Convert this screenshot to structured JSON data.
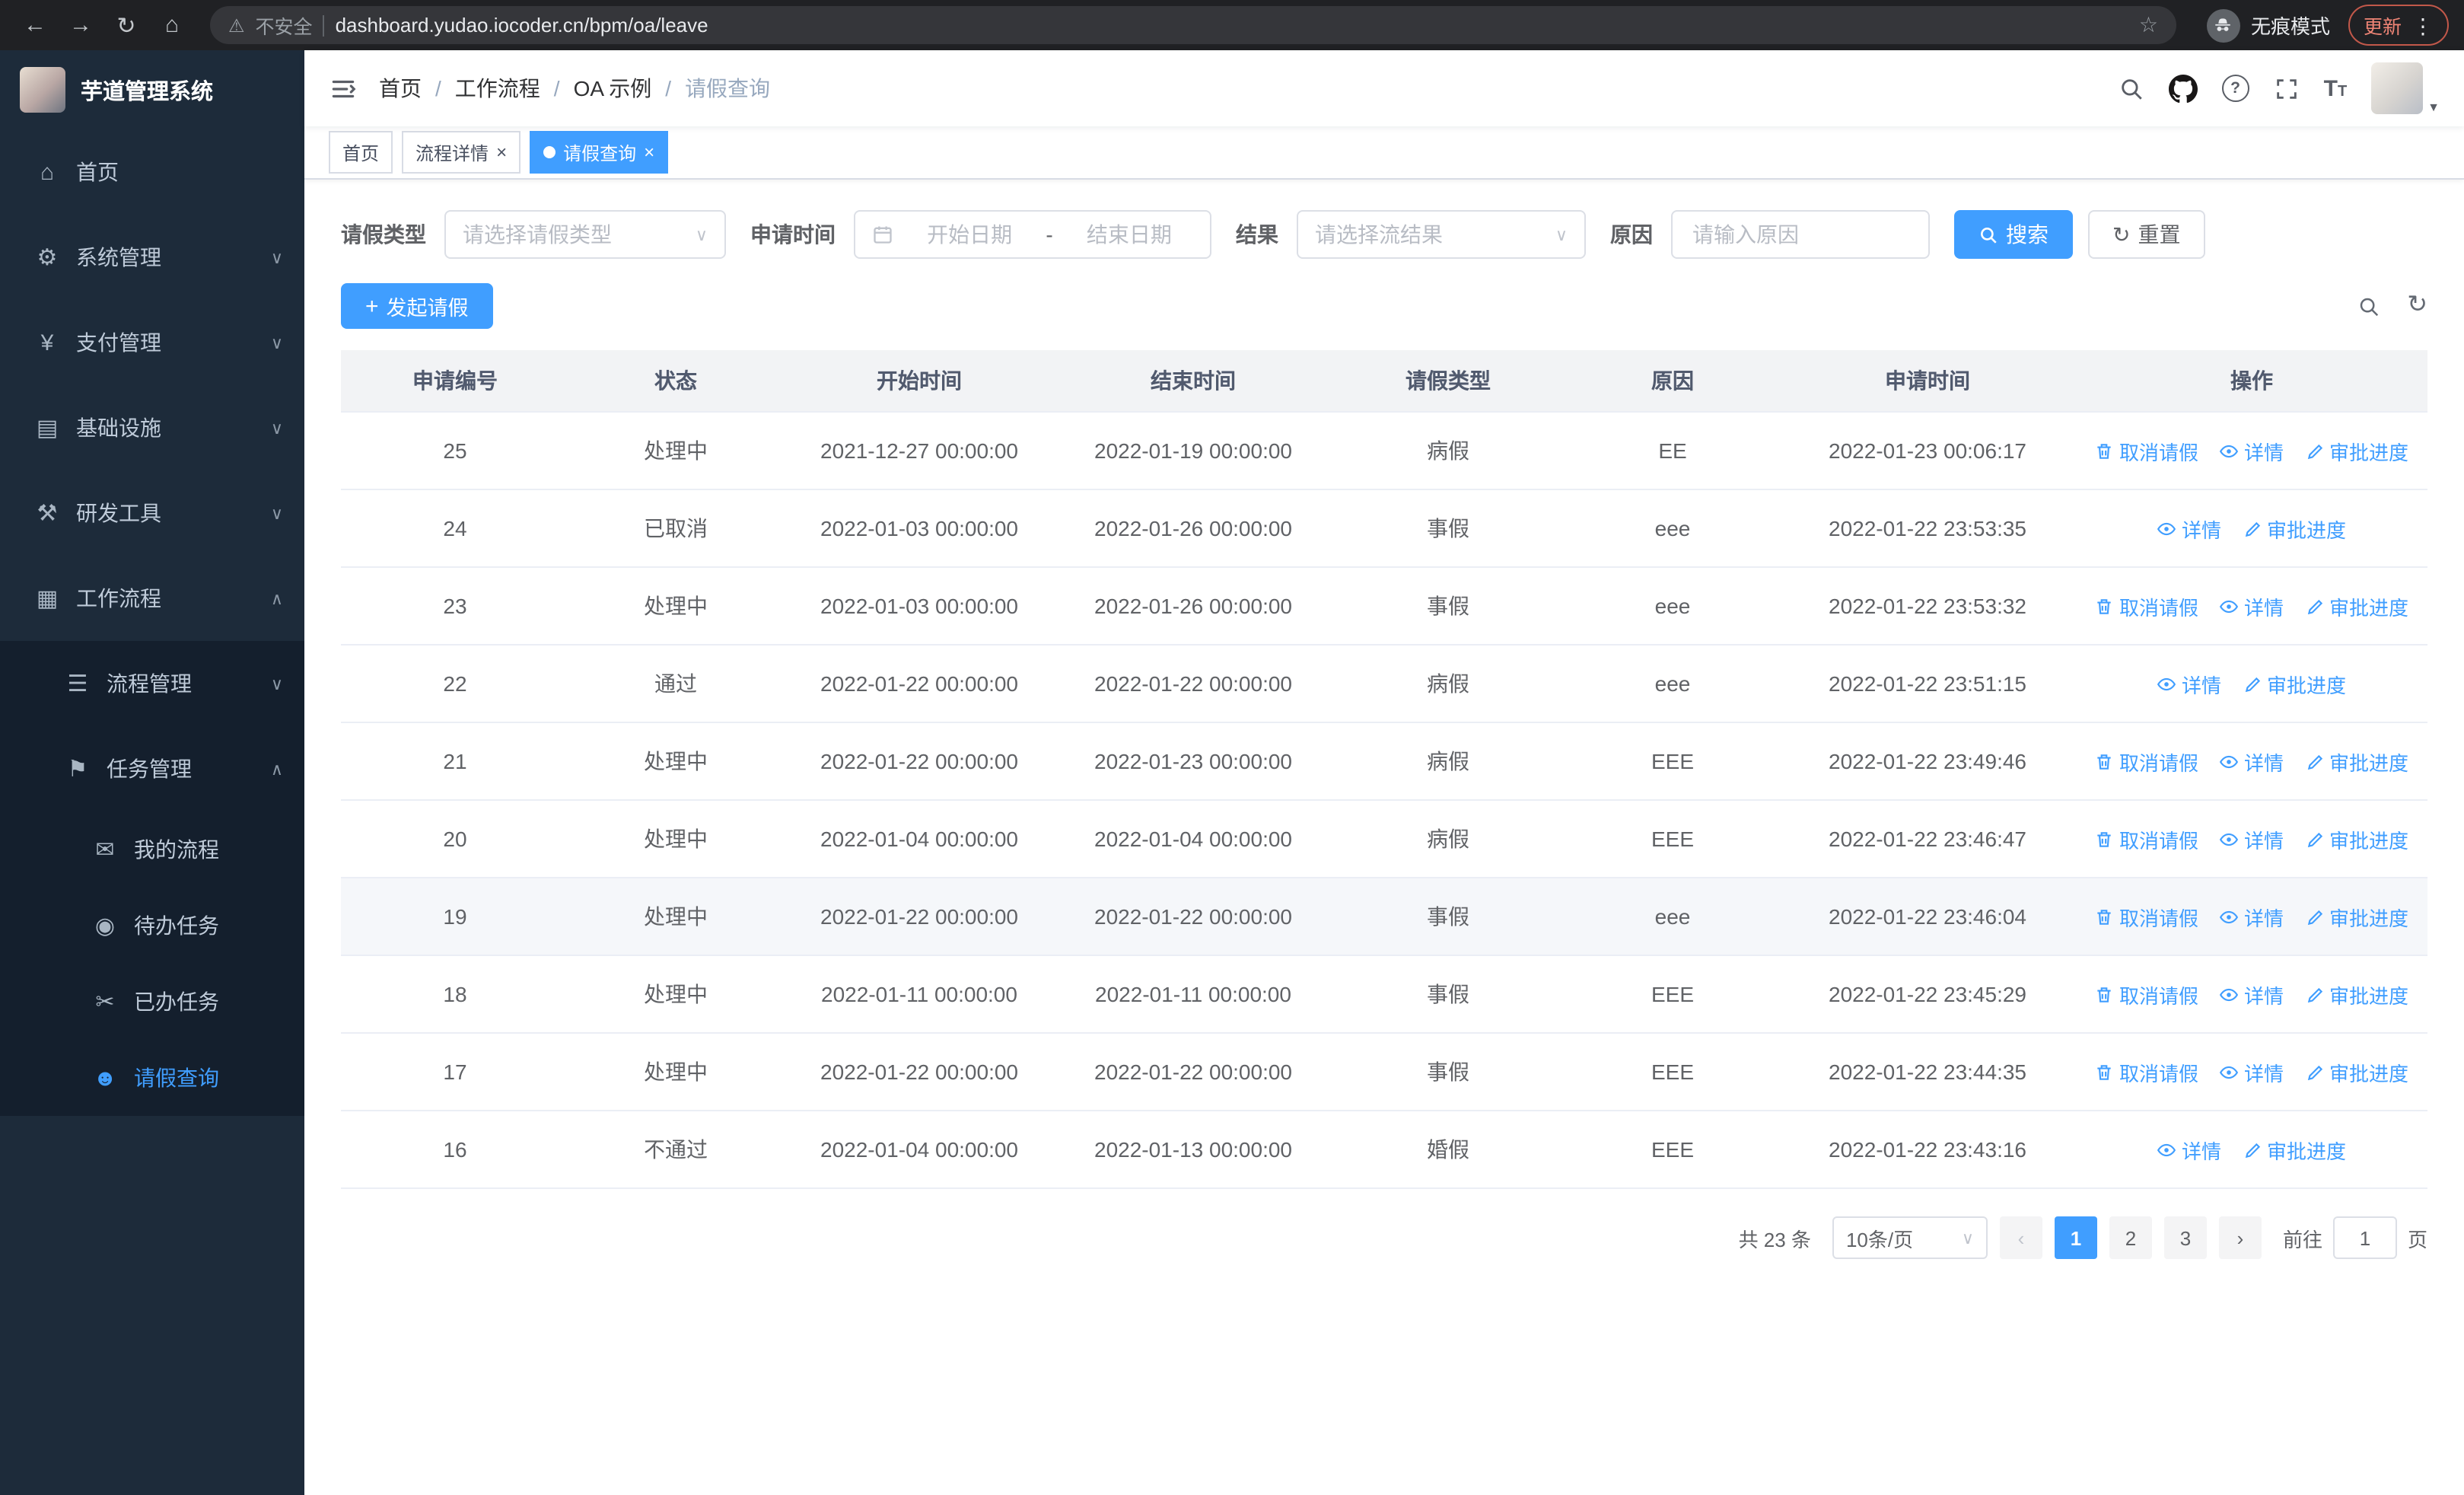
{
  "colors": {
    "accent": "#409eff"
  },
  "icons": {
    "back": "←",
    "forward": "→",
    "reload": "↻",
    "home_nav": "⌂",
    "star": "☆",
    "warning": "⚠",
    "menu_dots": "⋮",
    "home": "⌂",
    "gear": "⚙",
    "yen": "¥",
    "infra": "▤",
    "tools": "⚒",
    "workflow": "▦",
    "process": "☰",
    "tasks": "⚑",
    "my_process": "✉",
    "todo": "◉",
    "done": "✂",
    "user": "☻",
    "chevron_down": "∨",
    "chevron_up": "∧",
    "caret_down": "▼",
    "plus": "+",
    "refresh": "↻",
    "prev": "‹",
    "next": "›",
    "close": "×",
    "range_separator": "-"
  },
  "browser": {
    "security_warning": "不安全",
    "url": "dashboard.yudao.iocoder.cn/bpm/oa/leave",
    "incognito_label": "无痕模式",
    "update_label": "更新"
  },
  "sidebar": {
    "logo_title": "芋道管理系统",
    "items": [
      {
        "label": "首页"
      },
      {
        "label": "系统管理",
        "state": "collapsed"
      },
      {
        "label": "支付管理",
        "state": "collapsed"
      },
      {
        "label": "基础设施",
        "state": "collapsed"
      },
      {
        "label": "研发工具",
        "state": "collapsed"
      },
      {
        "label": "工作流程",
        "state": "expanded"
      },
      {
        "label": "流程管理",
        "state": "collapsed"
      },
      {
        "label": "任务管理",
        "state": "expanded"
      },
      {
        "label": "我的流程"
      },
      {
        "label": "待办任务"
      },
      {
        "label": "已办任务"
      },
      {
        "label": "请假查询",
        "active": true
      }
    ]
  },
  "header": {
    "breadcrumb": [
      "首页",
      "工作流程",
      "OA 示例",
      "请假查询"
    ]
  },
  "tabs": [
    {
      "label": "首页",
      "closable": false,
      "active": false
    },
    {
      "label": "流程详情",
      "closable": true,
      "active": false
    },
    {
      "label": "请假查询",
      "closable": true,
      "active": true
    }
  ],
  "filters": {
    "leave_type_label": "请假类型",
    "leave_type_placeholder": "请选择请假类型",
    "apply_time_label": "申请时间",
    "start_date_placeholder": "开始日期",
    "range_separator": "-",
    "end_date_placeholder": "结束日期",
    "result_label": "结果",
    "result_placeholder": "请选择流结果",
    "reason_label": "原因",
    "reason_placeholder": "请输入原因",
    "search_button": "搜索",
    "reset_button": "重置"
  },
  "toolbar": {
    "create_button": "发起请假"
  },
  "table": {
    "columns": [
      "申请编号",
      "状态",
      "开始时间",
      "结束时间",
      "请假类型",
      "原因",
      "申请时间",
      "操作"
    ],
    "action_labels": {
      "cancel": "取消请假",
      "detail": "详情",
      "progress": "审批进度"
    },
    "rows": [
      {
        "id": "25",
        "status": "处理中",
        "start": "2021-12-27 00:00:00",
        "end": "2022-01-19 00:00:00",
        "type": "病假",
        "reason": "EE",
        "apply_time": "2022-01-23 00:06:17",
        "actions": [
          "cancel",
          "detail",
          "progress"
        ]
      },
      {
        "id": "24",
        "status": "已取消",
        "start": "2022-01-03 00:00:00",
        "end": "2022-01-26 00:00:00",
        "type": "事假",
        "reason": "eee",
        "apply_time": "2022-01-22 23:53:35",
        "actions": [
          "detail",
          "progress"
        ]
      },
      {
        "id": "23",
        "status": "处理中",
        "start": "2022-01-03 00:00:00",
        "end": "2022-01-26 00:00:00",
        "type": "事假",
        "reason": "eee",
        "apply_time": "2022-01-22 23:53:32",
        "actions": [
          "cancel",
          "detail",
          "progress"
        ]
      },
      {
        "id": "22",
        "status": "通过",
        "start": "2022-01-22 00:00:00",
        "end": "2022-01-22 00:00:00",
        "type": "病假",
        "reason": "eee",
        "apply_time": "2022-01-22 23:51:15",
        "actions": [
          "detail",
          "progress"
        ]
      },
      {
        "id": "21",
        "status": "处理中",
        "start": "2022-01-22 00:00:00",
        "end": "2022-01-23 00:00:00",
        "type": "病假",
        "reason": "EEE",
        "apply_time": "2022-01-22 23:49:46",
        "actions": [
          "cancel",
          "detail",
          "progress"
        ]
      },
      {
        "id": "20",
        "status": "处理中",
        "start": "2022-01-04 00:00:00",
        "end": "2022-01-04 00:00:00",
        "type": "病假",
        "reason": "EEE",
        "apply_time": "2022-01-22 23:46:47",
        "actions": [
          "cancel",
          "detail",
          "progress"
        ]
      },
      {
        "id": "19",
        "status": "处理中",
        "start": "2022-01-22 00:00:00",
        "end": "2022-01-22 00:00:00",
        "type": "事假",
        "reason": "eee",
        "apply_time": "2022-01-22 23:46:04",
        "actions": [
          "cancel",
          "detail",
          "progress"
        ],
        "highlighted": true
      },
      {
        "id": "18",
        "status": "处理中",
        "start": "2022-01-11 00:00:00",
        "end": "2022-01-11 00:00:00",
        "type": "事假",
        "reason": "EEE",
        "apply_time": "2022-01-22 23:45:29",
        "actions": [
          "cancel",
          "detail",
          "progress"
        ]
      },
      {
        "id": "17",
        "status": "处理中",
        "start": "2022-01-22 00:00:00",
        "end": "2022-01-22 00:00:00",
        "type": "事假",
        "reason": "EEE",
        "apply_time": "2022-01-22 23:44:35",
        "actions": [
          "cancel",
          "detail",
          "progress"
        ]
      },
      {
        "id": "16",
        "status": "不通过",
        "start": "2022-01-04 00:00:00",
        "end": "2022-01-13 00:00:00",
        "type": "婚假",
        "reason": "EEE",
        "apply_time": "2022-01-22 23:43:16",
        "actions": [
          "detail",
          "progress"
        ]
      }
    ]
  },
  "pagination": {
    "total_text": "共 23 条",
    "page_size": "10条/页",
    "pages": [
      "1",
      "2",
      "3"
    ],
    "active_page": "1",
    "goto_label": "前往",
    "goto_value": "1",
    "page_suffix": "页"
  }
}
